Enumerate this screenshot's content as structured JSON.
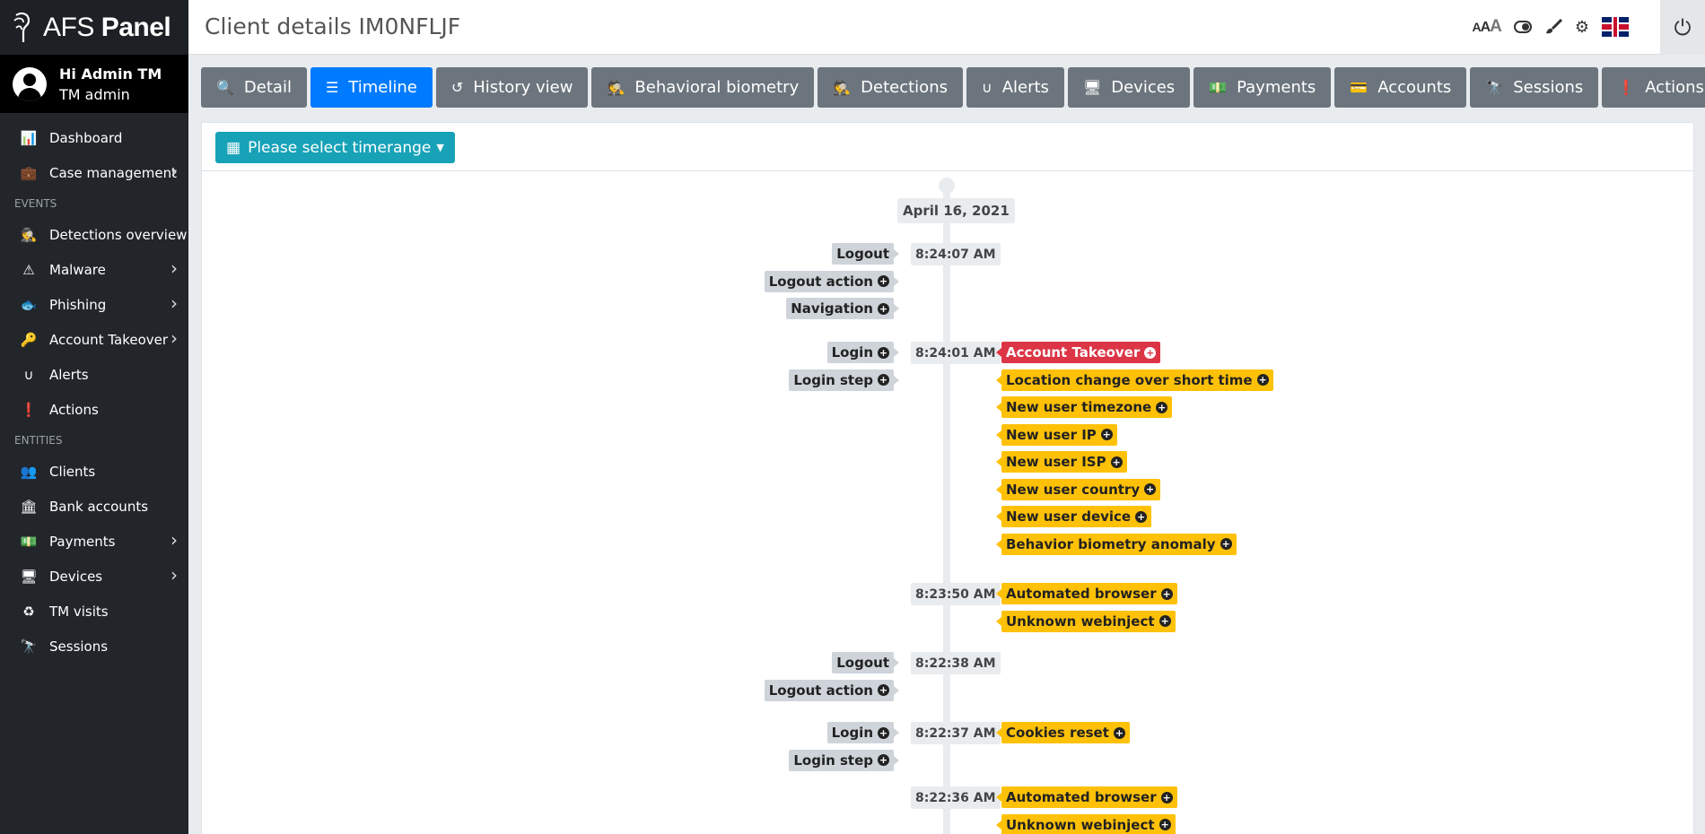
{
  "brand": {
    "title_light": "AFS ",
    "title_bold": "Panel"
  },
  "user": {
    "greeting": "Hi Admin TM",
    "role": "TM admin"
  },
  "sidebar": {
    "items_top": [
      {
        "label": "Dashboard",
        "icon": "chart-icon",
        "glyph": "📊",
        "has_sub": false
      },
      {
        "label": "Case management",
        "icon": "briefcase-icon",
        "glyph": "💼",
        "has_sub": true
      }
    ],
    "events_header": "EVENTS",
    "events": [
      {
        "label": "Detections overview",
        "icon": "spy-icon",
        "glyph": "🕵",
        "has_sub": false
      },
      {
        "label": "Malware",
        "icon": "warning-icon",
        "glyph": "⚠",
        "has_sub": true
      },
      {
        "label": "Phishing",
        "icon": "fish-icon",
        "glyph": "🐟",
        "has_sub": true
      },
      {
        "label": "Account Takeover",
        "icon": "key-icon",
        "glyph": "🔑",
        "has_sub": true
      },
      {
        "label": "Alerts",
        "icon": "magnet-icon",
        "glyph": "∪",
        "has_sub": false
      },
      {
        "label": "Actions",
        "icon": "exclamation-circle-icon",
        "glyph": "❗",
        "has_sub": false
      }
    ],
    "entities_header": "ENTITIES",
    "entities": [
      {
        "label": "Clients",
        "icon": "users-icon",
        "glyph": "👥",
        "has_sub": false
      },
      {
        "label": "Bank accounts",
        "icon": "bank-icon",
        "glyph": "🏛",
        "has_sub": false
      },
      {
        "label": "Payments",
        "icon": "money-icon",
        "glyph": "💵",
        "has_sub": true
      },
      {
        "label": "Devices",
        "icon": "desktop-icon",
        "glyph": "🖥",
        "has_sub": true
      },
      {
        "label": "TM visits",
        "icon": "recycle-icon",
        "glyph": "♻",
        "has_sub": false
      },
      {
        "label": "Sessions",
        "icon": "binoculars-icon",
        "glyph": "🔭",
        "has_sub": false
      }
    ]
  },
  "header": {
    "title": "Client details IM0NFLJF"
  },
  "tabs": [
    {
      "label": "Detail",
      "icon": "search-icon",
      "glyph": "🔍",
      "active": false
    },
    {
      "label": "Timeline",
      "icon": "list-icon",
      "glyph": "☰",
      "active": true
    },
    {
      "label": "History view",
      "icon": "history-icon",
      "glyph": "↺",
      "active": false
    },
    {
      "label": "Behavioral biometry",
      "icon": "spy-icon",
      "glyph": "🕵",
      "active": false
    },
    {
      "label": "Detections",
      "icon": "spy-icon",
      "glyph": "🕵",
      "active": false
    },
    {
      "label": "Alerts",
      "icon": "magnet-icon",
      "glyph": "∪",
      "active": false
    },
    {
      "label": "Devices",
      "icon": "desktop-icon",
      "glyph": "🖥",
      "active": false
    },
    {
      "label": "Payments",
      "icon": "money-icon",
      "glyph": "💵",
      "active": false
    },
    {
      "label": "Accounts",
      "icon": "card-icon",
      "glyph": "💳",
      "active": false
    },
    {
      "label": "Sessions",
      "icon": "binoculars-icon",
      "glyph": "🔭",
      "active": false
    },
    {
      "label": "Actions",
      "icon": "exclamation-circle-icon",
      "glyph": "❗",
      "active": false
    }
  ],
  "timerange": {
    "label": "Please select timerange"
  },
  "timeline": {
    "date": "April 16, 2021",
    "groups": [
      {
        "time": "8:24:07 AM",
        "left": [
          {
            "label": "Logout",
            "expandable": false
          },
          {
            "label": "Logout action",
            "expandable": true
          },
          {
            "label": "Navigation",
            "expandable": true
          }
        ],
        "right": []
      },
      {
        "time": "8:24:01 AM",
        "left": [
          {
            "label": "Login",
            "expandable": true
          },
          {
            "label": "Login step",
            "expandable": true
          }
        ],
        "right": [
          {
            "label": "Account Takeover",
            "severity": "danger"
          },
          {
            "label": "Location change over short time",
            "severity": "warning"
          },
          {
            "label": "New user timezone",
            "severity": "warning"
          },
          {
            "label": "New user IP",
            "severity": "warning"
          },
          {
            "label": "New user ISP",
            "severity": "warning"
          },
          {
            "label": "New user country",
            "severity": "warning"
          },
          {
            "label": "New user device",
            "severity": "warning"
          },
          {
            "label": "Behavior biometry anomaly",
            "severity": "warning"
          }
        ]
      },
      {
        "time": "8:23:50 AM",
        "left": [],
        "right": [
          {
            "label": "Automated browser",
            "severity": "warning"
          },
          {
            "label": "Unknown webinject",
            "severity": "warning"
          }
        ]
      },
      {
        "time": "8:22:38 AM",
        "left": [
          {
            "label": "Logout",
            "expandable": false
          },
          {
            "label": "Logout action",
            "expandable": true
          }
        ],
        "right": []
      },
      {
        "time": "8:22:37 AM",
        "left": [
          {
            "label": "Login",
            "expandable": true
          },
          {
            "label": "Login step",
            "expandable": true
          }
        ],
        "right": [
          {
            "label": "Cookies reset",
            "severity": "warning"
          }
        ]
      },
      {
        "time": "8:22:36 AM",
        "left": [],
        "right": [
          {
            "label": "Automated browser",
            "severity": "warning"
          },
          {
            "label": "Unknown webinject",
            "severity": "warning"
          }
        ]
      }
    ]
  },
  "colors": {
    "sidebar": "#22262b",
    "tab": "#6c757d",
    "tab_active": "#007bff",
    "timerange": "#17a2b8",
    "warning": "#ffc107",
    "danger": "#dc3545",
    "event": "#ced4da"
  }
}
